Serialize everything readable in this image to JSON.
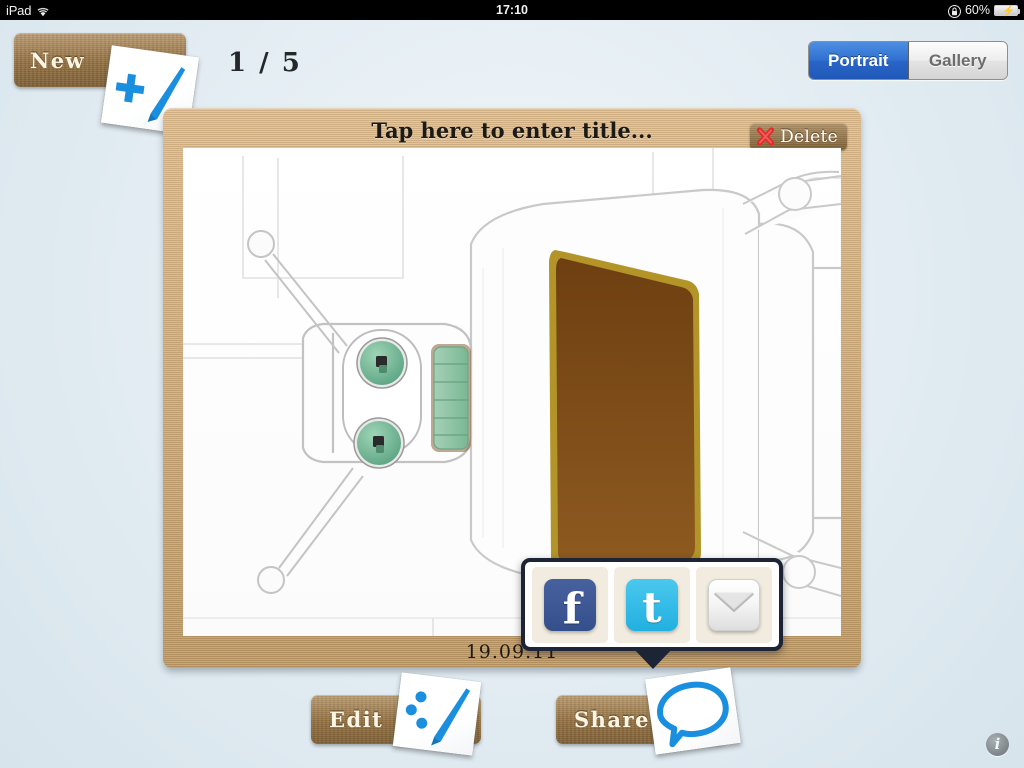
{
  "status_bar": {
    "device": "iPad",
    "wifi_icon": "wifi-icon",
    "time": "17:10",
    "rotation_lock_icon": "rotation-lock-icon",
    "battery_percent": "60%",
    "battery_icon": "battery-charging-icon"
  },
  "toolbar": {
    "new_label": "New",
    "new_icon": "new-sketch-icon",
    "page_counter": "1 / 5",
    "segmented": {
      "options": [
        "Portrait",
        "Gallery"
      ],
      "selected": "Portrait",
      "active_color": "#2f6fd0",
      "inactive_color": "#e4e4e4"
    }
  },
  "frame": {
    "title_placeholder": "Tap here to enter title...",
    "delete_label": "Delete",
    "delete_icon": "red-x-icon",
    "date": "19.09.11",
    "frame_color": "#d2ab74",
    "photo": {
      "alt_name": "sketch-filtered-robot-photo",
      "orientation": "rotated-90",
      "eye_color": "#7cbb9a",
      "mouth_color": "#8fc4a6",
      "chest_panel_color": "#7a4a18",
      "chest_panel_border": "#b39428"
    }
  },
  "share_popover": {
    "visible": true,
    "border_color": "#1d2436",
    "items": [
      {
        "name": "facebook",
        "glyph": "f",
        "color": "#3b5998"
      },
      {
        "name": "twitter",
        "glyph": "t",
        "color": "#33bbee"
      },
      {
        "name": "email",
        "glyph": "envelope",
        "color": "#efefef"
      }
    ]
  },
  "bottom_bar": {
    "edit_label": "Edit",
    "edit_icon": "edit-pen-icon",
    "share_label": "Share",
    "share_icon": "speech-bubble-icon",
    "info_label": "i",
    "info_icon": "info-icon"
  },
  "theme": {
    "background": "#e7eff4",
    "wood": "#a57e48",
    "accent_blue": "#1a8fe0"
  }
}
